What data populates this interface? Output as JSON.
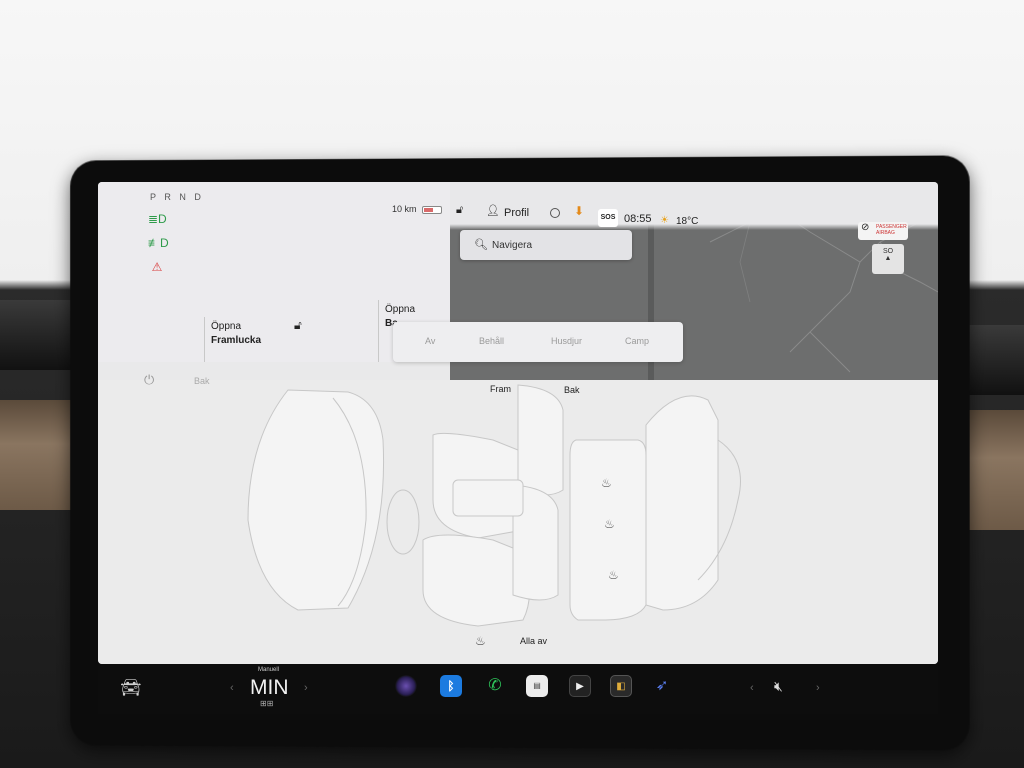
{
  "status": {
    "gear": "P R N D",
    "range": "10 km",
    "battery_level": 0.55,
    "indicators": [
      "low-beam-icon",
      "fog-light-icon",
      "seatbelt-warning-icon"
    ],
    "indicator_colors": {
      "green": "#2e9b4a",
      "red": "#d93c3c"
    }
  },
  "trunks": {
    "front": {
      "line1": "Öppna",
      "line2": "Framlucka"
    },
    "rear": {
      "line1": "Öppna",
      "line2": "Ba"
    }
  },
  "topbar": {
    "profile_label": "Profil",
    "sos": "SOS",
    "time": "08:55",
    "temperature": "18°C",
    "airbag_text": "PASSENGER AIRBAG",
    "compass": "SO"
  },
  "navigation": {
    "search_placeholder": "Navigera"
  },
  "climate_modes": {
    "off": "Av",
    "keep": "Behåll",
    "dog": "Husdjur",
    "camp": "Camp"
  },
  "seat_heaters": {
    "rear_toggle_label": "Bak",
    "front_label": "Fram",
    "rear_label": "Bak",
    "all_off_label": "Alla av"
  },
  "taskbar": {
    "climate_mode_label": "Manuell",
    "cabin_temp": "MIN",
    "apps": [
      "camera-icon",
      "bluetooth-icon",
      "phone-icon",
      "calendar-icon",
      "media-icon",
      "toybox-icon",
      "navigation-icon"
    ],
    "volume_state": "muted"
  }
}
